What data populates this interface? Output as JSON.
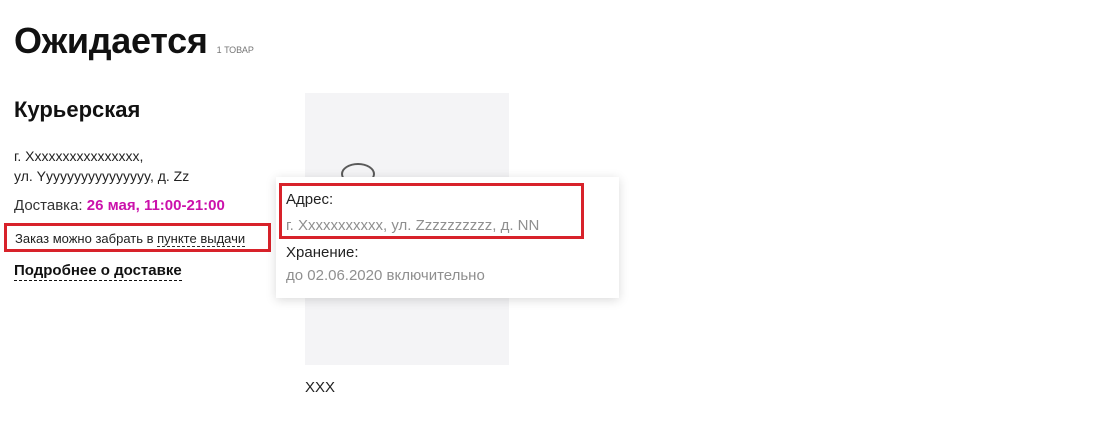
{
  "header": {
    "title": "Ожидается",
    "count": "1 ТОВАР"
  },
  "delivery": {
    "type": "Курьерская",
    "address_line1": "г. Xxxxxxxxxxxxxxxx,",
    "address_line2": "ул. Yyyyyyyyyyyyyyyy, д. Zz",
    "date_label": "Доставка:",
    "date_value": "26 мая, 11:00-21:00",
    "pickup_text": "Заказ можно забрать в ",
    "pickup_link": "пункте выдачи",
    "details_link": "Подробнее о доставке",
    "accent_color": "#cb11ab"
  },
  "product": {
    "name": "XXX"
  },
  "tooltip": {
    "address_label": "Адрес:",
    "address_value": "г. Xxxxxxxxxxx, ул. Zzzzzzzzzz, д. NN",
    "storage_label": "Хранение:",
    "storage_value": "до 02.06.2020 включительно"
  },
  "highlight_color": "#d8222a"
}
